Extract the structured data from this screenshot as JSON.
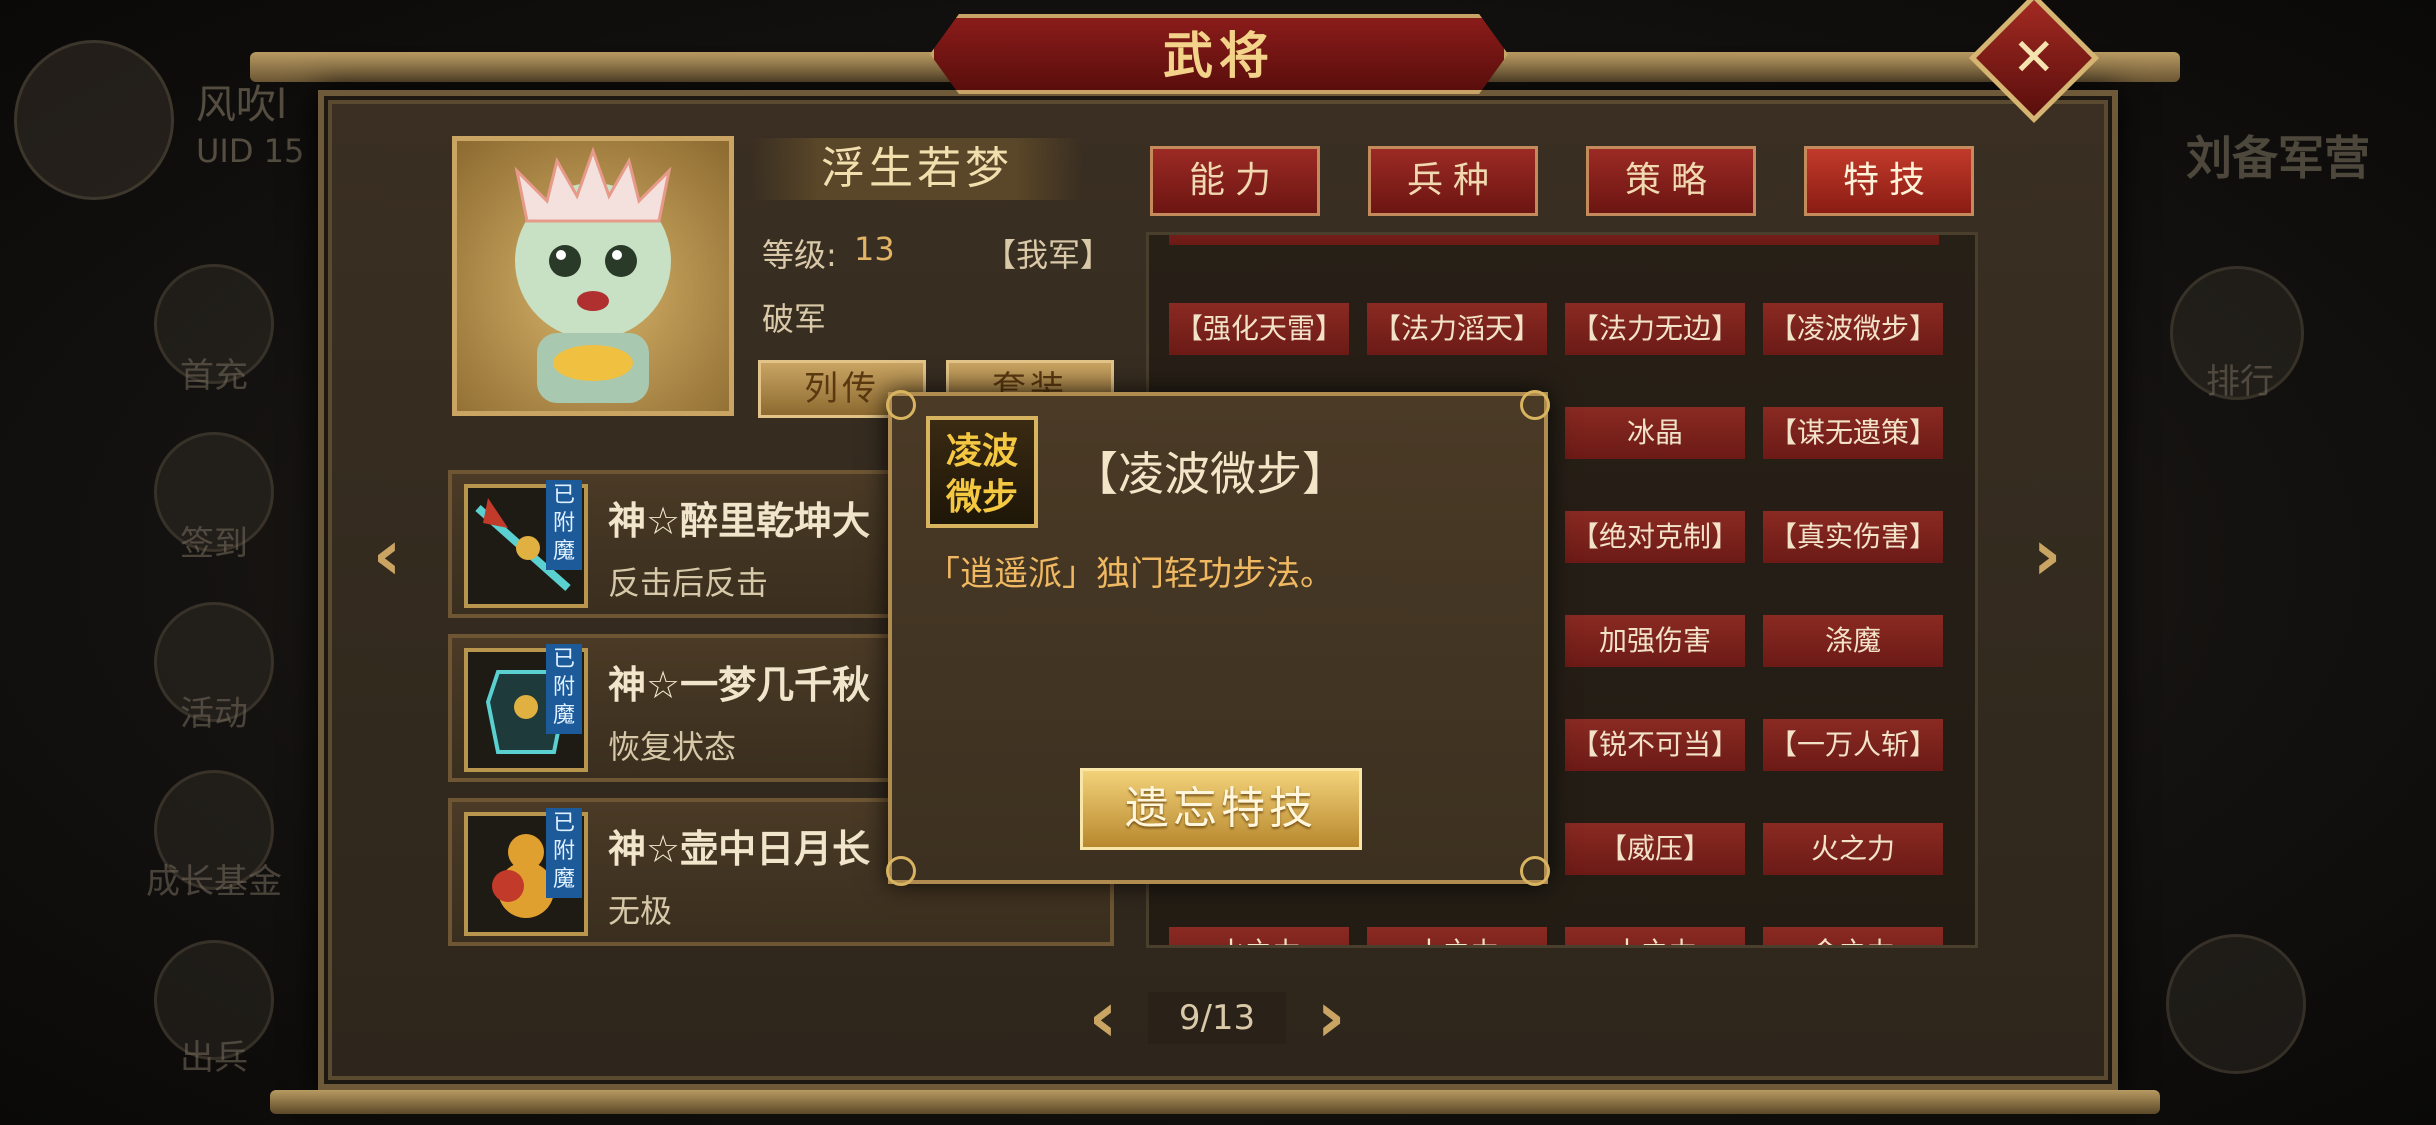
{
  "title": "武将",
  "left_sidebar": {
    "player_name": "风吹l",
    "uid_label": "UID  15",
    "items": [
      "首充",
      "签到",
      "活动",
      "成长基金",
      "出兵"
    ]
  },
  "right_sidebar": {
    "camp_name": "刘备军营",
    "items": [
      "排行"
    ]
  },
  "general": {
    "name": "浮生若梦",
    "level_label": "等级:",
    "level_value": "13",
    "faction": "【我军】",
    "trait": "破军",
    "biography_button": "列传",
    "equipment_button": "套装"
  },
  "tabs": [
    {
      "label": "能力",
      "active": false
    },
    {
      "label": "兵种",
      "active": false
    },
    {
      "label": "策略",
      "active": false
    },
    {
      "label": "特技",
      "active": true
    }
  ],
  "equipment": [
    {
      "name": "神☆醉里乾坤大",
      "effect": "反击后反击",
      "badge": "已附魔"
    },
    {
      "name": "神☆一梦几千秋",
      "effect": "恢复状态",
      "badge": "已附魔"
    },
    {
      "name": "神☆壶中日月长",
      "effect": "无极",
      "badge": "已附魔"
    }
  ],
  "skills": {
    "row1": [
      "【强化天雷】",
      "【法力滔天】",
      "【法力无边】",
      "【凌波微步】"
    ],
    "row2": [
      "冰晶",
      "【谋无遗策】"
    ],
    "row3": [
      "【绝对克制】",
      "【真实伤害】"
    ],
    "row4": [
      "加强伤害",
      "涤魔"
    ],
    "row5": [
      "【锐不可当】",
      "【一万人斩】"
    ],
    "row6": [
      "【威压】",
      "火之力"
    ],
    "row7": [
      "水之力",
      "土之力",
      "木之力",
      "金之力"
    ]
  },
  "popup": {
    "icon_text": "凌波微步",
    "title": "【凌波微步】",
    "description": "「逍遥派」独门轻功步法。",
    "forget_button": "遗忘特技"
  },
  "pagination": {
    "current": "9/13"
  },
  "colors": {
    "tab_red": "#9c2a24",
    "gold": "#c9a463",
    "desc_orange": "#f0b860",
    "badge_blue": "#1d5a9a"
  },
  "icons": {
    "close": "close-x-icon",
    "prev": "chevron-left-icon",
    "next": "chevron-right-icon"
  }
}
